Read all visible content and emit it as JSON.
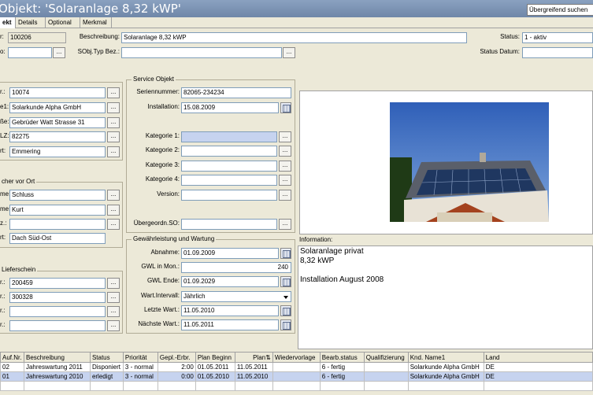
{
  "window": {
    "title": "Objekt: 'Solaranlage 8,32 kWP'",
    "search_button": "Übergreifend suchen"
  },
  "tabs": [
    "ekt",
    "Details",
    "Optional",
    "Merkmal"
  ],
  "header": {
    "id_label": "r:",
    "id_value": "100206",
    "row2_label": "o:",
    "row2_value": "",
    "row2_btn": "...",
    "desc_label": "Beschreibung:",
    "desc_value": "Solaranlage 8,32 kWP",
    "typ_label": "SObj.Typ Bez.:",
    "typ_value": "",
    "typ_btn": "...",
    "status_label": "Status:",
    "status_value": "1 - aktiv",
    "status_date_label": "Status Datum:",
    "status_date_value": ""
  },
  "customer": {
    "fields": [
      {
        "label": "r.:",
        "value": "10074"
      },
      {
        "label": "e1:",
        "value": "Solarkunde Alpha GmbH"
      },
      {
        "label": "ße:",
        "value": "Gebrüder Watt Strasse 31"
      },
      {
        "label": "LZ:",
        "value": "82275"
      },
      {
        "label": "rt:",
        "value": "Emmering"
      }
    ],
    "btn": "..."
  },
  "contact": {
    "title": "cher vor Ort",
    "fields": [
      {
        "label": "me:",
        "value": "Schluss"
      },
      {
        "label": "me:",
        "value": "Kurt"
      },
      {
        "label": "z.:",
        "value": ""
      },
      {
        "label": "rt:",
        "value": "Dach Süd-Ost"
      }
    ]
  },
  "delivery": {
    "title": "Lieferschein",
    "fields": [
      {
        "label": "r.:",
        "value": "200459"
      },
      {
        "label": "r.:",
        "value": "300328"
      },
      {
        "label": "r.:",
        "value": ""
      },
      {
        "label": "r.:",
        "value": ""
      }
    ]
  },
  "service": {
    "title": "Service Objekt",
    "serial_label": "Seriennummer:",
    "serial_value": "82065-234234",
    "install_label": "Installation:",
    "install_value": "15.08.2009",
    "cats": [
      {
        "label": "Kategorie 1:",
        "value": ""
      },
      {
        "label": "Kategorie 2:",
        "value": ""
      },
      {
        "label": "Kategorie 3:",
        "value": ""
      },
      {
        "label": "Kategorie 4:",
        "value": ""
      }
    ],
    "version_label": "Version:",
    "version_value": "",
    "parent_label": "Übergeordn.SO:",
    "parent_value": ""
  },
  "warranty": {
    "title": "Gewährleistung und Wartung",
    "abnahme_label": "Abnahme:",
    "abnahme_value": "01.09.2009",
    "gwl_mon_label": "GWL in Mon.:",
    "gwl_mon_value": "240",
    "gwl_end_label": "GWL Ende:",
    "gwl_end_value": "01.09.2029",
    "interval_label": "Wart.Intervall:",
    "interval_value": "Jährlich",
    "last_label": "Letzte Wart.:",
    "last_value": "11.05.2010",
    "next_label": "Nächste Wart.:",
    "next_value": "11.05.2011"
  },
  "info": {
    "label": "Information:",
    "lines": [
      "Solaranlage privat",
      "8,32 kWP",
      "",
      "Installation August 2008"
    ]
  },
  "table": {
    "headers": [
      "Auf.Nr.",
      "Beschreibung",
      "Status",
      "Priorität",
      "Gepl.-Erbr.",
      "Plan Beginn",
      "Plan",
      "Wiedervorlage",
      "Bearb.status",
      "Qualifizierung",
      "Knd. Name1",
      "Land"
    ],
    "rows": [
      [
        "02",
        "Jahreswartung 2011",
        "Disponiert",
        "3 - normal",
        "2:00",
        "01.05.2011",
        "11.05.2011",
        "",
        "6 - fertig",
        "",
        "Solarkunde Alpha GmbH",
        "DE"
      ],
      [
        "01",
        "Jahreswartung 2010",
        "erledigt",
        "3 - normal",
        "0:00",
        "01.05.2010",
        "11.05.2010",
        "",
        "6 - fertig",
        "",
        "Solarkunde Alpha GmbH",
        "DE"
      ]
    ]
  },
  "colors": {
    "titlebar": "#7890b0",
    "selected_row": "#c6d3ef",
    "focused_field": "#c6d3ef"
  }
}
